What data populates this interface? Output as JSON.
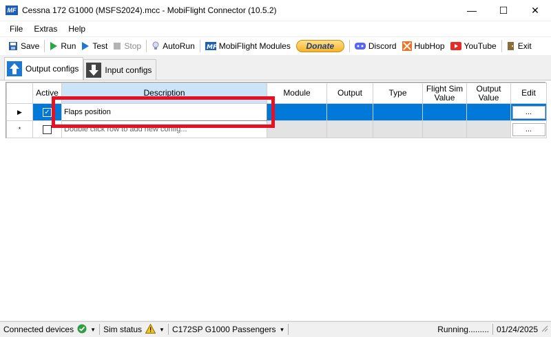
{
  "window": {
    "title": "Cessna 172 G1000 (MSFS2024).mcc - MobiFlight Connector (10.5.2)",
    "logo_text": "MF",
    "minimize": "—",
    "maximize": "☐",
    "close": "✕"
  },
  "menu": [
    "File",
    "Extras",
    "Help"
  ],
  "toolbar": {
    "save": "Save",
    "run": "Run",
    "test": "Test",
    "stop": "Stop",
    "autorun": "AutoRun",
    "modules": "MobiFlight Modules",
    "donate": "Donate",
    "discord": "Discord",
    "hubhop": "HubHop",
    "youtube": "YouTube",
    "exit": "Exit"
  },
  "tabs": {
    "output": "Output configs",
    "input": "Input configs"
  },
  "grid": {
    "columns": {
      "active": "Active",
      "description": "Description",
      "module": "Module",
      "output": "Output",
      "type": "Type",
      "flight_sim_value": "Flight Sim Value",
      "output_value": "Output Value",
      "edit": "Edit"
    },
    "rows": [
      {
        "marker": "▶",
        "active": true,
        "description": "Flaps position",
        "module": "",
        "output": "",
        "type": "",
        "flight_sim_value": "",
        "output_value": "",
        "edit": "..."
      }
    ],
    "new_row": {
      "marker": "*",
      "hint": "Double click row to add new config...",
      "edit": "..."
    }
  },
  "status": {
    "connected_devices": "Connected devices",
    "sim_status": "Sim status",
    "aircraft": "C172SP G1000 Passengers",
    "running": "Running.........",
    "date": "01/24/2025"
  },
  "colors": {
    "selection": "#0078d7",
    "highlight_box": "#e81123",
    "donate": "#f5b427"
  }
}
